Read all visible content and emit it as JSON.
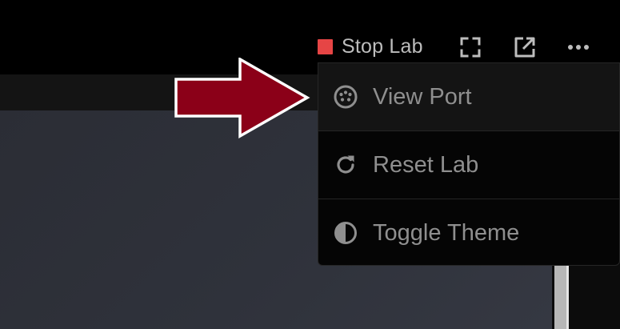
{
  "toolbar": {
    "stop_label": "Stop Lab",
    "stop_color": "#e64545",
    "icons": [
      "expand-icon",
      "open-external-icon",
      "more-icon"
    ]
  },
  "menu": {
    "items": [
      {
        "label": "View Port",
        "icon": "port-icon",
        "highlighted": true
      },
      {
        "label": "Reset Lab",
        "icon": "refresh-icon",
        "highlighted": false
      },
      {
        "label": "Toggle Theme",
        "icon": "contrast-icon",
        "highlighted": false
      }
    ]
  },
  "annotation": {
    "arrow_color": "#8b0018",
    "arrow_outline": "#ffffff"
  }
}
